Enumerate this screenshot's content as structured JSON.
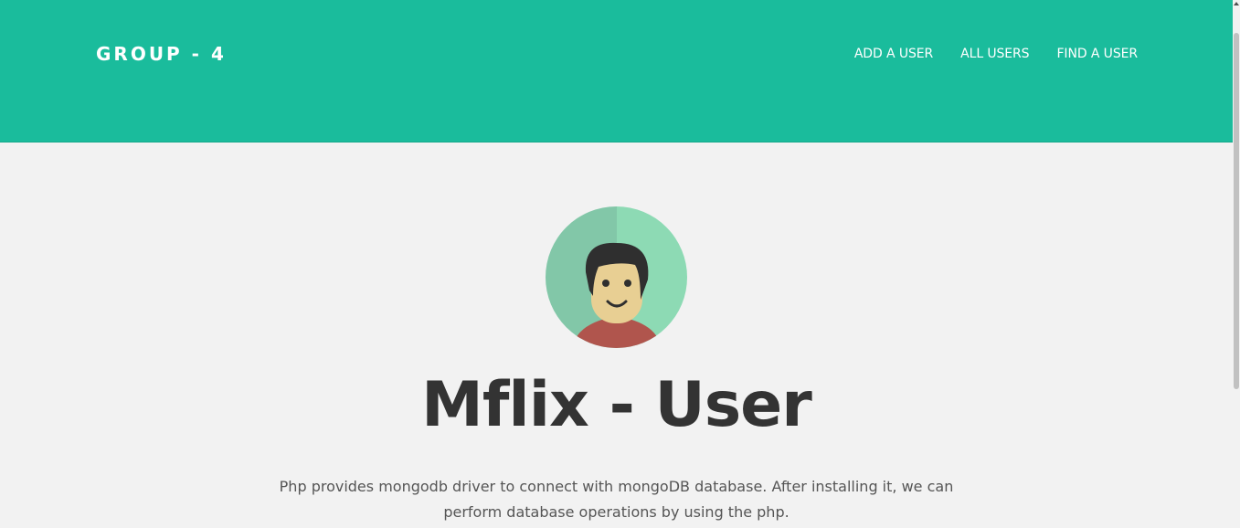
{
  "navbar": {
    "brand": "GROUP - 4",
    "links": [
      "ADD A USER",
      "ALL USERS",
      "FIND A USER"
    ]
  },
  "masthead": {
    "avatar_icon": "user-avatar-icon",
    "title": "Mflix - User",
    "lead": "Php provides mongodb driver to connect with mongoDB database. After installing it, we can perform database operations by using the php."
  },
  "colors": {
    "primary": "#1abc9c",
    "background": "#f2f2f2",
    "heading": "#333333",
    "text": "#555555"
  }
}
